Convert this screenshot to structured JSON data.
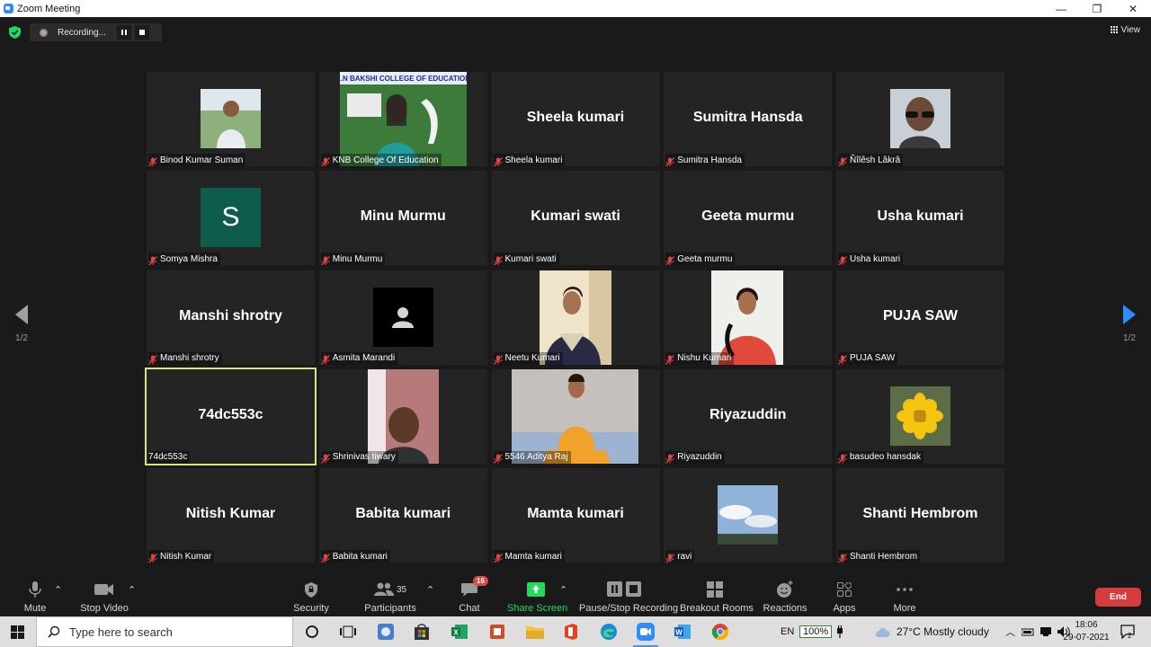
{
  "window": {
    "title": "Zoom Meeting",
    "minimize": "—",
    "maximize": "❐",
    "close": "✕"
  },
  "recording": {
    "label": "Recording..."
  },
  "view": {
    "label": "View"
  },
  "pagination": {
    "left": "1/2",
    "right": "1/2"
  },
  "tiles": [
    {
      "name": "Binod Kumar Suman",
      "display": "",
      "type": "photo",
      "photo": "man-outdoor"
    },
    {
      "name": "KNB College Of Education",
      "display": "",
      "type": "video",
      "photo": "college-banner"
    },
    {
      "name": "Sheela kumari",
      "display": "Sheela kumari",
      "type": "name"
    },
    {
      "name": "Sumitra Hansda",
      "display": "Sumitra Hansda",
      "type": "name"
    },
    {
      "name": "Ñîlêsh Lâkrâ",
      "display": "",
      "type": "photo",
      "photo": "man-sunglasses"
    },
    {
      "name": "Somya Mishra",
      "display": "S",
      "type": "initial"
    },
    {
      "name": "Minu Murmu",
      "display": "Minu Murmu",
      "type": "name"
    },
    {
      "name": "Kumari swati",
      "display": "Kumari swati",
      "type": "name"
    },
    {
      "name": "Geeta murmu",
      "display": "Geeta murmu",
      "type": "name"
    },
    {
      "name": "Usha kumari",
      "display": "Usha kumari",
      "type": "name"
    },
    {
      "name": "Manshi shrotry",
      "display": "Manshi shrotry",
      "type": "name"
    },
    {
      "name": "Asmita Marandi",
      "display": "",
      "type": "avatar"
    },
    {
      "name": "Neetu Kumari",
      "display": "",
      "type": "video",
      "photo": "girl-dark-dress"
    },
    {
      "name": "Nishu Kumari",
      "display": "",
      "type": "video",
      "photo": "girl-red-dress"
    },
    {
      "name": "PUJA SAW",
      "display": "PUJA SAW",
      "type": "name"
    },
    {
      "name": "74dc553c",
      "display": "74dc553c",
      "type": "name",
      "active": true
    },
    {
      "name": "Shrinivas tiwary",
      "display": "",
      "type": "video",
      "photo": "man-room"
    },
    {
      "name": "5546 Aditya Raj",
      "display": "",
      "type": "video",
      "photo": "girl-yellow-dress"
    },
    {
      "name": "Riyazuddin",
      "display": "Riyazuddin",
      "type": "name"
    },
    {
      "name": "basudeo hansdak",
      "display": "",
      "type": "photo",
      "photo": "yellow-flower"
    },
    {
      "name": "Nitish Kumar",
      "display": "Nitish Kumar",
      "type": "name"
    },
    {
      "name": "Babita kumari",
      "display": "Babita kumari",
      "type": "name"
    },
    {
      "name": "Mamta kumari",
      "display": "Mamta kumari",
      "type": "name"
    },
    {
      "name": "ravi",
      "display": "",
      "type": "photo",
      "photo": "sky"
    },
    {
      "name": "Shanti Hembrom",
      "display": "Shanti Hembrom",
      "type": "name"
    }
  ],
  "toolbar": {
    "mute": "Mute",
    "stop_video": "Stop Video",
    "security": "Security",
    "participants": "Participants",
    "participants_count": "35",
    "chat": "Chat",
    "chat_badge": "16",
    "share_screen": "Share Screen",
    "recording": "Pause/Stop Recording",
    "breakout": "Breakout Rooms",
    "reactions": "Reactions",
    "apps": "Apps",
    "more": "More",
    "end": "End"
  },
  "taskbar": {
    "search_placeholder": "Type here to search",
    "lang": "EN",
    "battery": "100%",
    "weather": "27°C  Mostly cloudy",
    "time": "18:06",
    "date": "29-07-2021",
    "notifications": "2"
  },
  "colors": {
    "accent": "#2d8cff",
    "active_speaker": "#d7e675",
    "end": "#d63c3c",
    "share": "#23d959",
    "muted": "#e04646"
  }
}
